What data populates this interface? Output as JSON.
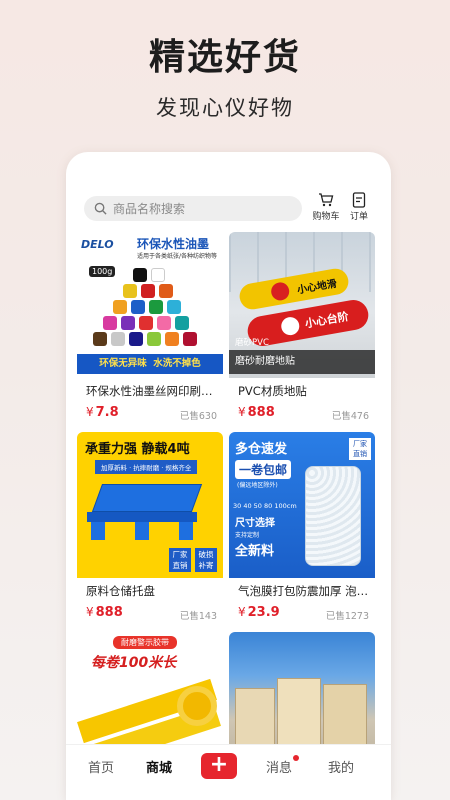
{
  "hero": {
    "title": "精选好货",
    "subtitle": "发现心仪好物"
  },
  "search": {
    "placeholder": "商品名称搜索",
    "icon": "search-icon"
  },
  "top_actions": [
    {
      "label": "购物车",
      "icon": "cart-icon"
    },
    {
      "label": "订单",
      "icon": "order-icon"
    }
  ],
  "products": [
    {
      "name": "环保水性油墨丝网印刷水性油墨",
      "price": "7.8",
      "sold": "已售630",
      "image": {
        "brand": "DELO",
        "headline": "环保水性油墨",
        "subline": "适用于各类纸张/各种纺织物等",
        "tag": "100g",
        "banner": "环保无异味  水洗不掉色"
      }
    },
    {
      "name": "PVC材质地贴",
      "price": "888",
      "sold": "已售476",
      "image": {
        "sign1": "小心地滑",
        "sign2": "小心台阶",
        "tag": "磨砂PVC",
        "caption": "磨砂耐磨地贴"
      }
    },
    {
      "name": "原料仓储托盘",
      "price": "888",
      "sold": "已售143",
      "image": {
        "headline": "承重力强 静载4吨",
        "subline": "加厚新料 · 抗摔耐磨 · 规格齐全",
        "badge1": "厂家直销",
        "badge2": "破损补寄"
      }
    },
    {
      "name": "气泡膜打包防震加厚 泡沫垫",
      "price": "23.9",
      "sold": "已售1273",
      "image": {
        "headline": "多仓速发",
        "roll": "一卷包邮",
        "subline": "(偏远地区除外)",
        "sizes": "30 40 50 80 100cm",
        "size_label": "尺寸选择",
        "new_material": "全新料",
        "badge": "厂家直销",
        "custom": "支持定制"
      }
    },
    {
      "name": "",
      "price": "",
      "sold": "",
      "image": {
        "tag": "耐磨警示胶带",
        "headline": "每卷100米长"
      }
    },
    {
      "name": "",
      "price": "",
      "sold": "",
      "image": {}
    }
  ],
  "currency": "¥",
  "tabbar": {
    "items": [
      "首页",
      "商城",
      "消息",
      "我的"
    ],
    "active": "商城",
    "plus": "+"
  },
  "colors": {
    "accent": "#e6262e",
    "price": "#e0202a",
    "background": "#f6e8e4"
  }
}
